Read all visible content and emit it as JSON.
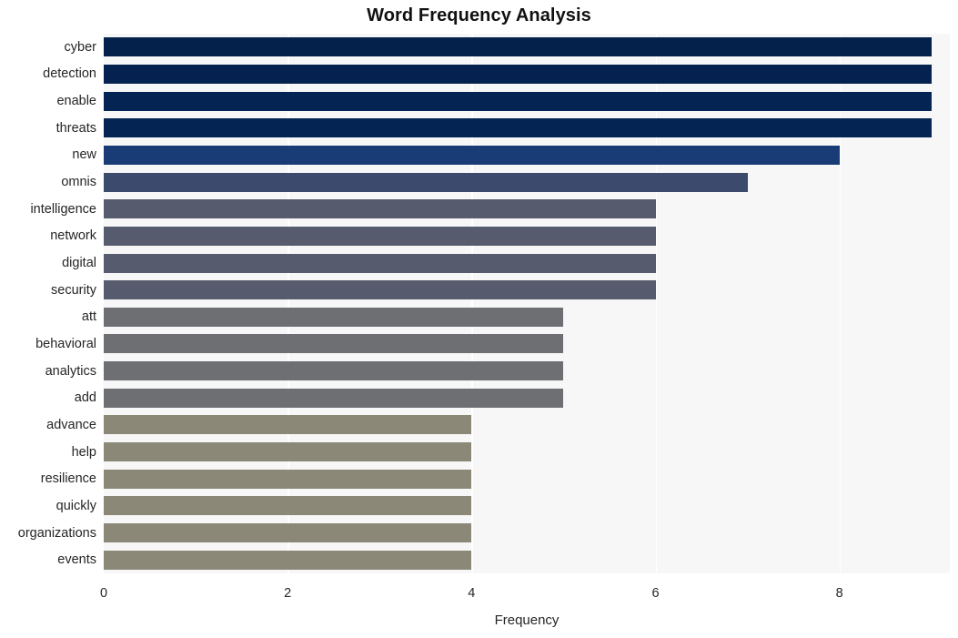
{
  "chart_data": {
    "type": "bar",
    "orientation": "horizontal",
    "title": "Word Frequency Analysis",
    "xlabel": "Frequency",
    "ylabel": "",
    "xlim": [
      0,
      9.2
    ],
    "xticks": [
      0,
      2,
      4,
      6,
      8
    ],
    "grid": true,
    "legend": null,
    "categories": [
      "cyber",
      "detection",
      "enable",
      "threats",
      "new",
      "omnis",
      "intelligence",
      "network",
      "digital",
      "security",
      "att",
      "behavioral",
      "analytics",
      "add",
      "advance",
      "help",
      "resilience",
      "quickly",
      "organizations",
      "events"
    ],
    "values": [
      9,
      9,
      9,
      9,
      8,
      7,
      6,
      6,
      6,
      6,
      5,
      5,
      5,
      5,
      4,
      4,
      4,
      4,
      4,
      4
    ],
    "bar_colors": [
      "#04214c",
      "#042150",
      "#042454",
      "#042454",
      "#193b76",
      "#3c4a6d",
      "#565c6e",
      "#565c6e",
      "#565c6e",
      "#565c6e",
      "#6d6f73",
      "#6d6f73",
      "#6d6f73",
      "#6d6f73",
      "#8b8878",
      "#8b8878",
      "#8b8878",
      "#8b8878",
      "#8b8878",
      "#8b8878"
    ],
    "plot_background": "#f7f7f7",
    "gridline_color": "#ffffff",
    "figure_background": "#ffffff"
  }
}
